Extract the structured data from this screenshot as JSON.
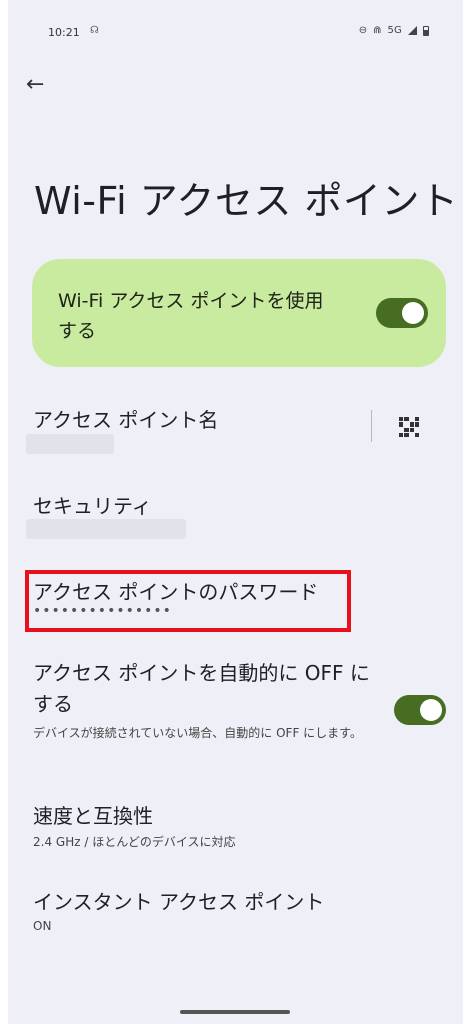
{
  "status_bar": {
    "time": "10:21",
    "network": "5G"
  },
  "page": {
    "title": "Wi-Fi アクセス ポイント"
  },
  "main_toggle": {
    "label": "Wi-Fi アクセス ポイントを使用する",
    "checked": true
  },
  "items": {
    "ap_name": {
      "title": "アクセス ポイント名"
    },
    "security": {
      "title": "セキュリティ"
    },
    "password": {
      "title": "アクセス ポイントのパスワード",
      "value": "•••••••••••••••"
    },
    "auto_off": {
      "title": "アクセス ポイントを自動的に OFF にする",
      "subtitle": "デバイスが接続されていない場合、自動的に OFF にします。",
      "checked": true
    },
    "speed": {
      "title": "速度と互換性",
      "subtitle": "2.4 GHz / ほとんどのデバイスに対応"
    },
    "instant": {
      "title": "インスタント アクセス ポイント",
      "subtitle": "ON"
    }
  },
  "colors": {
    "background": "#eff0f7",
    "card": "#c9eba0",
    "toggle_on": "#466d22",
    "highlight": "#e8101d"
  },
  "icons": [
    "back-arrow-icon",
    "qr-code-icon",
    "dnd-icon",
    "signal-icon",
    "battery-icon"
  ]
}
